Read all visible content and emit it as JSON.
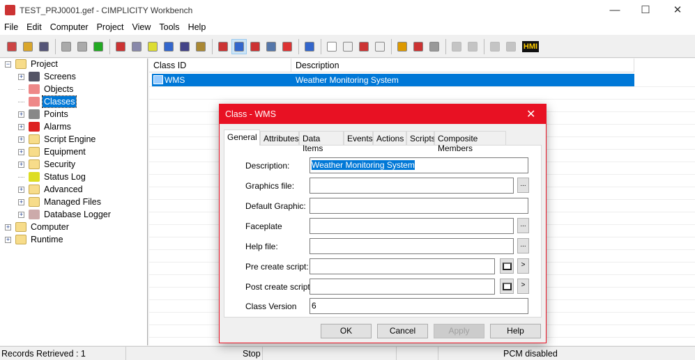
{
  "window": {
    "title": "TEST_PRJ0001.gef - CIMPLICITY Workbench",
    "minimize": "—",
    "maximize": "☐",
    "close": "✕"
  },
  "menu": [
    "File",
    "Edit",
    "Computer",
    "Project",
    "View",
    "Tools",
    "Help"
  ],
  "toolbar": {
    "icons": [
      "new-project-icon",
      "open-icon",
      "print-icon",
      "|",
      "stop-hand-icon",
      "stop-icon",
      "run-icon",
      "|",
      "download-icon",
      "find-icon",
      "status-log-icon",
      "screen-icon",
      "workstation-icon",
      "wizard-icon",
      "|",
      "small-icons-icon",
      "details-view-icon",
      "tree-icon",
      "list-icon",
      "properties-icon",
      "|",
      "help-icon",
      "|",
      "new-icon",
      "copy-icon",
      "delete-icon",
      "duplicate-icon",
      "|",
      "open-folder-icon",
      "export-icon",
      "forward-icon",
      "|",
      "disabled-1-icon",
      "disabled-2-icon",
      "|",
      "disabled-3-icon",
      "disabled-4-icon",
      "hmi-icon"
    ],
    "hmi_label": "HMI",
    "active": "details-view-icon"
  },
  "tree": [
    {
      "label": "Project",
      "level": 0,
      "expander": "−",
      "icon": "folder-icon"
    },
    {
      "label": "Screens",
      "level": 1,
      "expander": "+",
      "icon": "screens-icon",
      "color": "#556"
    },
    {
      "label": "Objects",
      "level": 1,
      "expander": "",
      "icon": "objects-icon",
      "color": "#e88"
    },
    {
      "label": "Classes",
      "level": 1,
      "expander": "",
      "icon": "classes-icon",
      "color": "#e88",
      "selected": true
    },
    {
      "label": "Points",
      "level": 1,
      "expander": "+",
      "icon": "points-icon",
      "color": "#888"
    },
    {
      "label": "Alarms",
      "level": 1,
      "expander": "+",
      "icon": "alarms-icon",
      "color": "#d22"
    },
    {
      "label": "Script Engine",
      "level": 1,
      "expander": "+",
      "icon": "folder-icon"
    },
    {
      "label": "Equipment",
      "level": 1,
      "expander": "+",
      "icon": "folder-icon"
    },
    {
      "label": "Security",
      "level": 1,
      "expander": "+",
      "icon": "folder-icon"
    },
    {
      "label": "Status Log",
      "level": 1,
      "expander": "",
      "icon": "status-log-icon",
      "color": "#dd2"
    },
    {
      "label": "Advanced",
      "level": 1,
      "expander": "+",
      "icon": "folder-icon"
    },
    {
      "label": "Managed Files",
      "level": 1,
      "expander": "+",
      "icon": "folder-icon"
    },
    {
      "label": "Database Logger",
      "level": 1,
      "expander": "+",
      "icon": "database-logger-icon",
      "color": "#caa"
    },
    {
      "label": "Computer",
      "level": 0,
      "expander": "+",
      "icon": "folder-icon"
    },
    {
      "label": "Runtime",
      "level": 0,
      "expander": "+",
      "icon": "folder-icon"
    }
  ],
  "list": {
    "columns": [
      "Class ID",
      "Description"
    ],
    "rows": [
      {
        "class_id": "WMS",
        "description": "Weather Monitoring System"
      }
    ]
  },
  "status": {
    "records": "Records Retrieved : 1",
    "state": "Stop",
    "pcm": "PCM disabled"
  },
  "dialog": {
    "title": "Class - WMS",
    "close": "✕",
    "tabs": [
      "General",
      "Attributes",
      "Data Items",
      "Events",
      "Actions",
      "Scripts",
      "Composite Members"
    ],
    "fields": {
      "description": {
        "label": "Description:",
        "value": "Weather Monitoring System"
      },
      "graphics_file": {
        "label": "Graphics file:",
        "value": ""
      },
      "default_graphic": {
        "label": "Default Graphic:",
        "value": ""
      },
      "faceplate": {
        "label": "Faceplate",
        "value": ""
      },
      "help_file": {
        "label": "Help file:",
        "value": ""
      },
      "pre_create_script": {
        "label": "Pre create script:",
        "value": ""
      },
      "post_create_script": {
        "label": "Post create script:",
        "value": ""
      },
      "class_version": {
        "label": "Class Version",
        "value": "6"
      }
    },
    "browse": "...",
    "arrow": ">",
    "buttons": {
      "ok": "OK",
      "cancel": "Cancel",
      "apply": "Apply",
      "help": "Help"
    }
  }
}
